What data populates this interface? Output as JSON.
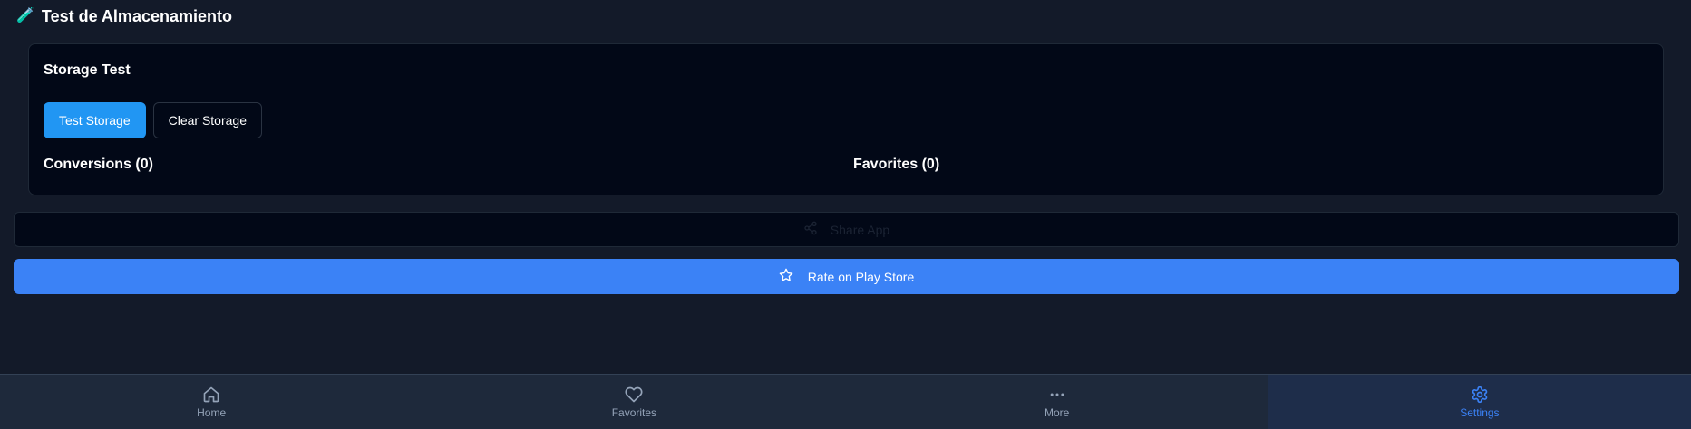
{
  "section": {
    "emoji": "🧪",
    "title": "Test de Almacenamiento"
  },
  "card": {
    "title": "Storage Test",
    "test_button": "Test Storage",
    "clear_button": "Clear Storage",
    "conversions_label": "Conversions (0)",
    "favorites_label": "Favorites (0)"
  },
  "share": {
    "label": "Share App",
    "icon": "share-icon"
  },
  "rate": {
    "label": "Rate on Play Store",
    "icon": "star-icon"
  },
  "nav": {
    "items": [
      {
        "label": "Home",
        "icon": "home-icon"
      },
      {
        "label": "Favorites",
        "icon": "heart-icon"
      },
      {
        "label": "More",
        "icon": "more-icon"
      },
      {
        "label": "Settings",
        "icon": "gear-icon"
      }
    ],
    "active": "Settings"
  },
  "colors": {
    "background": "#131a29",
    "card": "#020817",
    "primary": "#2196f3",
    "accent": "#3b82f6",
    "nav_background": "#1e293b"
  }
}
